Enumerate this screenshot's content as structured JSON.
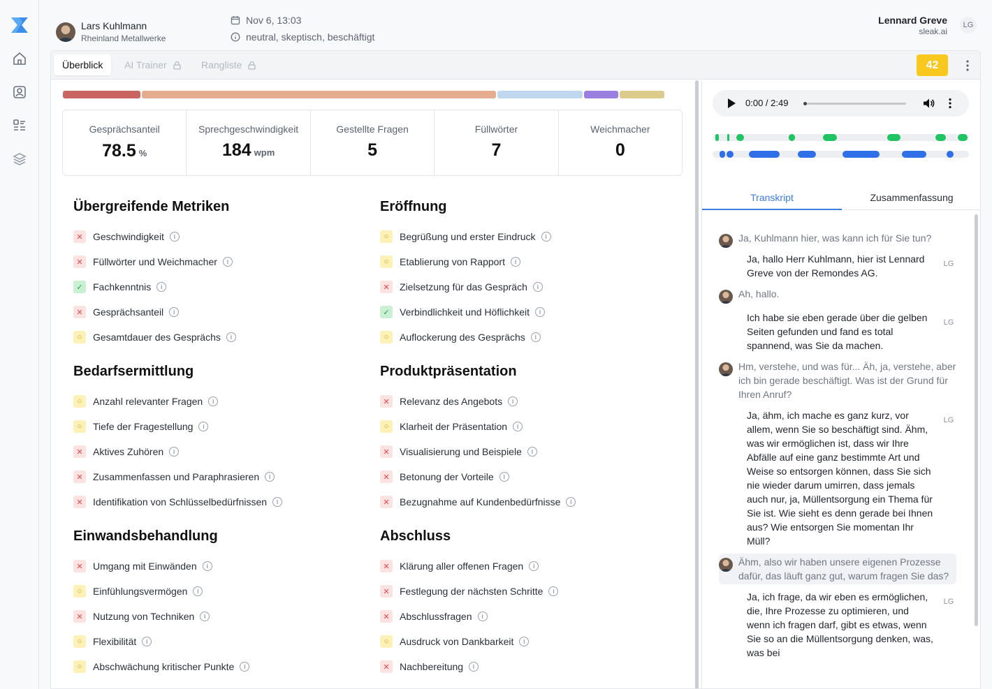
{
  "sidebar": {
    "items": [
      {
        "icon": "home-icon"
      },
      {
        "icon": "contact-card-icon"
      },
      {
        "icon": "checklist-icon"
      },
      {
        "icon": "layers-icon"
      }
    ]
  },
  "header": {
    "customer_name": "Lars Kuhlmann",
    "customer_company": "Rheinland Metallwerke",
    "datetime": "Nov 6, 13:03",
    "mood": "neutral, skeptisch, beschäftigt",
    "user_name": "Lennard Greve",
    "user_domain": "sleak.ai",
    "user_initials": "LG"
  },
  "tabs": {
    "overview": "Überblick",
    "ai_trainer": "AI Trainer",
    "ranking": "Rangliste"
  },
  "score": "42",
  "stats": [
    {
      "label": "Gesprächsanteil",
      "value": "78.5",
      "unit": "%"
    },
    {
      "label": "Sprechgeschwindigkeit",
      "value": "184",
      "unit": "wpm"
    },
    {
      "label": "Gestellte Fragen",
      "value": "5",
      "unit": ""
    },
    {
      "label": "Füllwörter",
      "value": "7",
      "unit": ""
    },
    {
      "label": "Weichmacher",
      "value": "0",
      "unit": ""
    }
  ],
  "colors": {
    "red": "#c96461",
    "salmon": "#e6ac90",
    "lightblue": "#bfd8f0",
    "purple": "#9b7fe0",
    "khaki": "#dccb8a",
    "green": "#1fc463",
    "blue": "#2f6fe8",
    "accent": "#3b7de0",
    "score": "#f8c81e"
  },
  "sections": [
    {
      "title": "Übergreifende Metriken",
      "items": [
        {
          "label": "Geschwindigkeit",
          "status": "x"
        },
        {
          "label": "Füllwörter und Weichmacher",
          "status": "x"
        },
        {
          "label": "Fachkenntnis",
          "status": "c"
        },
        {
          "label": "Gesprächsanteil",
          "status": "x"
        },
        {
          "label": "Gesamtdauer des Gesprächs",
          "status": "o"
        }
      ]
    },
    {
      "title": "Eröffnung",
      "items": [
        {
          "label": "Begrüßung und erster Eindruck",
          "status": "o"
        },
        {
          "label": "Etablierung von Rapport",
          "status": "o"
        },
        {
          "label": "Zielsetzung für das Gespräch",
          "status": "x"
        },
        {
          "label": "Verbindlichkeit und Höflichkeit",
          "status": "c"
        },
        {
          "label": "Auflockerung des Gesprächs",
          "status": "o"
        }
      ]
    },
    {
      "title": "Bedarfsermittlung",
      "items": [
        {
          "label": "Anzahl relevanter Fragen",
          "status": "o"
        },
        {
          "label": "Tiefe der Fragestellung",
          "status": "o"
        },
        {
          "label": "Aktives Zuhören",
          "status": "x"
        },
        {
          "label": "Zusammenfassen und Paraphrasieren",
          "status": "x"
        },
        {
          "label": "Identifikation von Schlüsselbedürfnissen",
          "status": "x"
        }
      ]
    },
    {
      "title": "Produktpräsentation",
      "items": [
        {
          "label": "Relevanz des Angebots",
          "status": "x"
        },
        {
          "label": "Klarheit der Präsentation",
          "status": "o"
        },
        {
          "label": "Visualisierung und Beispiele",
          "status": "x"
        },
        {
          "label": "Betonung der Vorteile",
          "status": "x"
        },
        {
          "label": "Bezugnahme auf Kundenbedürfnisse",
          "status": "x"
        }
      ]
    },
    {
      "title": "Einwandsbehandlung",
      "items": [
        {
          "label": "Umgang mit Einwänden",
          "status": "x"
        },
        {
          "label": "Einfühlungsvermögen",
          "status": "o"
        },
        {
          "label": "Nutzung von Techniken",
          "status": "x"
        },
        {
          "label": "Flexibilität",
          "status": "o"
        },
        {
          "label": "Abschwächung kritischer Punkte",
          "status": "o"
        }
      ]
    },
    {
      "title": "Abschluss",
      "items": [
        {
          "label": "Klärung aller offenen Fragen",
          "status": "x"
        },
        {
          "label": "Festlegung der nächsten Schritte",
          "status": "x"
        },
        {
          "label": "Abschlussfragen",
          "status": "x"
        },
        {
          "label": "Ausdruck von Dankbarkeit",
          "status": "o"
        },
        {
          "label": "Nachbereitung",
          "status": "x"
        }
      ]
    }
  ],
  "audio": {
    "time": "0:00 / 2:49",
    "progress": 0
  },
  "right_tabs": {
    "transcript": "Transkript",
    "summary": "Zusammenfassung"
  },
  "transcript": [
    {
      "speaker": "customer",
      "text": "Ja, Kuhlmann hier, was kann ich für Sie tun?"
    },
    {
      "speaker": "agent",
      "text": "Ja, hallo Herr Kuhlmann, hier ist Lennard Greve von der Remondes AG."
    },
    {
      "speaker": "customer",
      "text": "Ah, hallo."
    },
    {
      "speaker": "agent",
      "text": "Ich habe sie eben gerade über die gelben Seiten gefunden und fand es total spannend, was Sie da machen."
    },
    {
      "speaker": "customer",
      "text": "Hm, verstehe, und was für... Äh, ja, verstehe, aber ich bin gerade beschäftigt. Was ist der Grund für Ihren Anruf?"
    },
    {
      "speaker": "agent",
      "text": "Ja, ähm, ich mache es ganz kurz, vor allem, wenn Sie so beschäftigt sind. Ähm, was wir ermöglichen ist, dass wir Ihre Abfälle auf eine ganz bestimmte Art und Weise so entsorgen können, dass Sie sich nie wieder darum umirren, dass jemals auch nur, ja, Müllentsorgung ein Thema für Sie ist. Wie sieht es denn gerade bei Ihnen aus? Wie entsorgen Sie momentan Ihr Müll?"
    },
    {
      "speaker": "customer",
      "text": "Ähm, also wir haben unsere eigenen Prozesse dafür, das läuft ganz gut, warum fragen Sie das?",
      "highlight": true
    },
    {
      "speaker": "agent",
      "text": "Ja, ich frage, da wir eben es ermöglichen, die, Ihre Prozesse zu optimieren, und wenn ich fragen darf, gibt es etwas, wenn Sie so an die Müllentsorgung denken, was, was bei"
    }
  ]
}
